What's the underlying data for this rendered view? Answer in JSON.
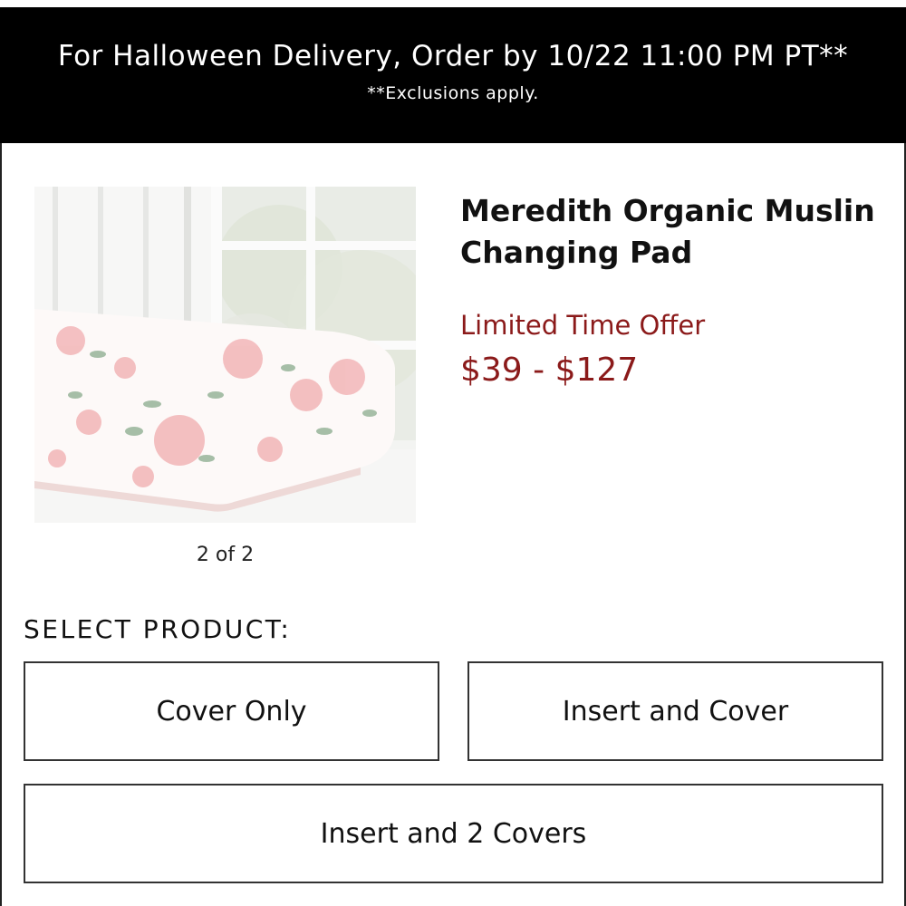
{
  "banner": {
    "headline": "For Halloween Delivery, Order by 10/22 11:00 PM PT**",
    "subtext": "**Exclusions apply."
  },
  "product": {
    "title_line1": "Meredith Organic Muslin",
    "title_line2": "Changing Pad",
    "offer_label": "Limited Time Offer",
    "price_range": "$39 - $127",
    "image_counter": "2 of 2"
  },
  "selector": {
    "label": "SELECT PRODUCT:",
    "options": [
      {
        "label": "Cover Only"
      },
      {
        "label": "Insert and Cover"
      },
      {
        "label": "Insert and 2 Covers"
      }
    ]
  },
  "colors": {
    "banner_bg": "#000000",
    "banner_text": "#ffffff",
    "price_red": "#8b1a1a",
    "option_border": "#333333"
  }
}
